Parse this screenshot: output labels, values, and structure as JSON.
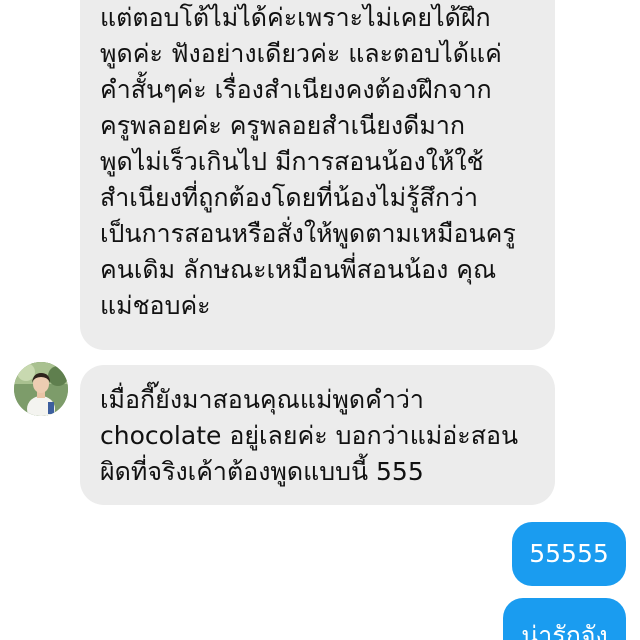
{
  "conversation": {
    "messages": [
      {
        "sender": "contact",
        "lines": [
          "แต่ตอบโต้ไม่ได้ค่ะเพราะไม่เคยได้ฝึก",
          "พูดค่ะ ฟังอย่างเดียวค่ะ และตอบได้แค่",
          "คำสั้นๆค่ะ เรื่องสำเนียงคงต้องฝึกจาก",
          "ครูพลอยค่ะ ครูพลอยสำเนียงดีมาก",
          "พูดไม่เร็วเกินไป มีการสอนน้องให้ใช้",
          "สำเนียงที่ถูกต้องโดยที่น้องไม่รู้สึกว่า",
          "เป็นการสอนหรือสั่งให้พูดตามเหมือนครู",
          "คนเดิม  ลักษณะเหมือนพี่สอนน้อง คุณ",
          "แม่ชอบค่ะ"
        ]
      },
      {
        "sender": "contact",
        "lines": [
          "เมื่อกี๊ยังมาสอนคุณแม่พูดคำว่า",
          "chocolate อยู่เลยค่ะ บอกว่าแม่อ่ะสอน",
          "ผิดที่จริงเค้าต้องพูดแบบนี้ 555"
        ]
      },
      {
        "sender": "me",
        "text": "55555"
      },
      {
        "sender": "me",
        "text": "น่ารักจัง"
      }
    ]
  },
  "colors": {
    "incoming_bubble": "#ececec",
    "outgoing_bubble": "#1a9cf0",
    "incoming_text": "#111111",
    "outgoing_text": "#ffffff"
  },
  "icons": {
    "avatar": "contact-avatar-photo"
  }
}
